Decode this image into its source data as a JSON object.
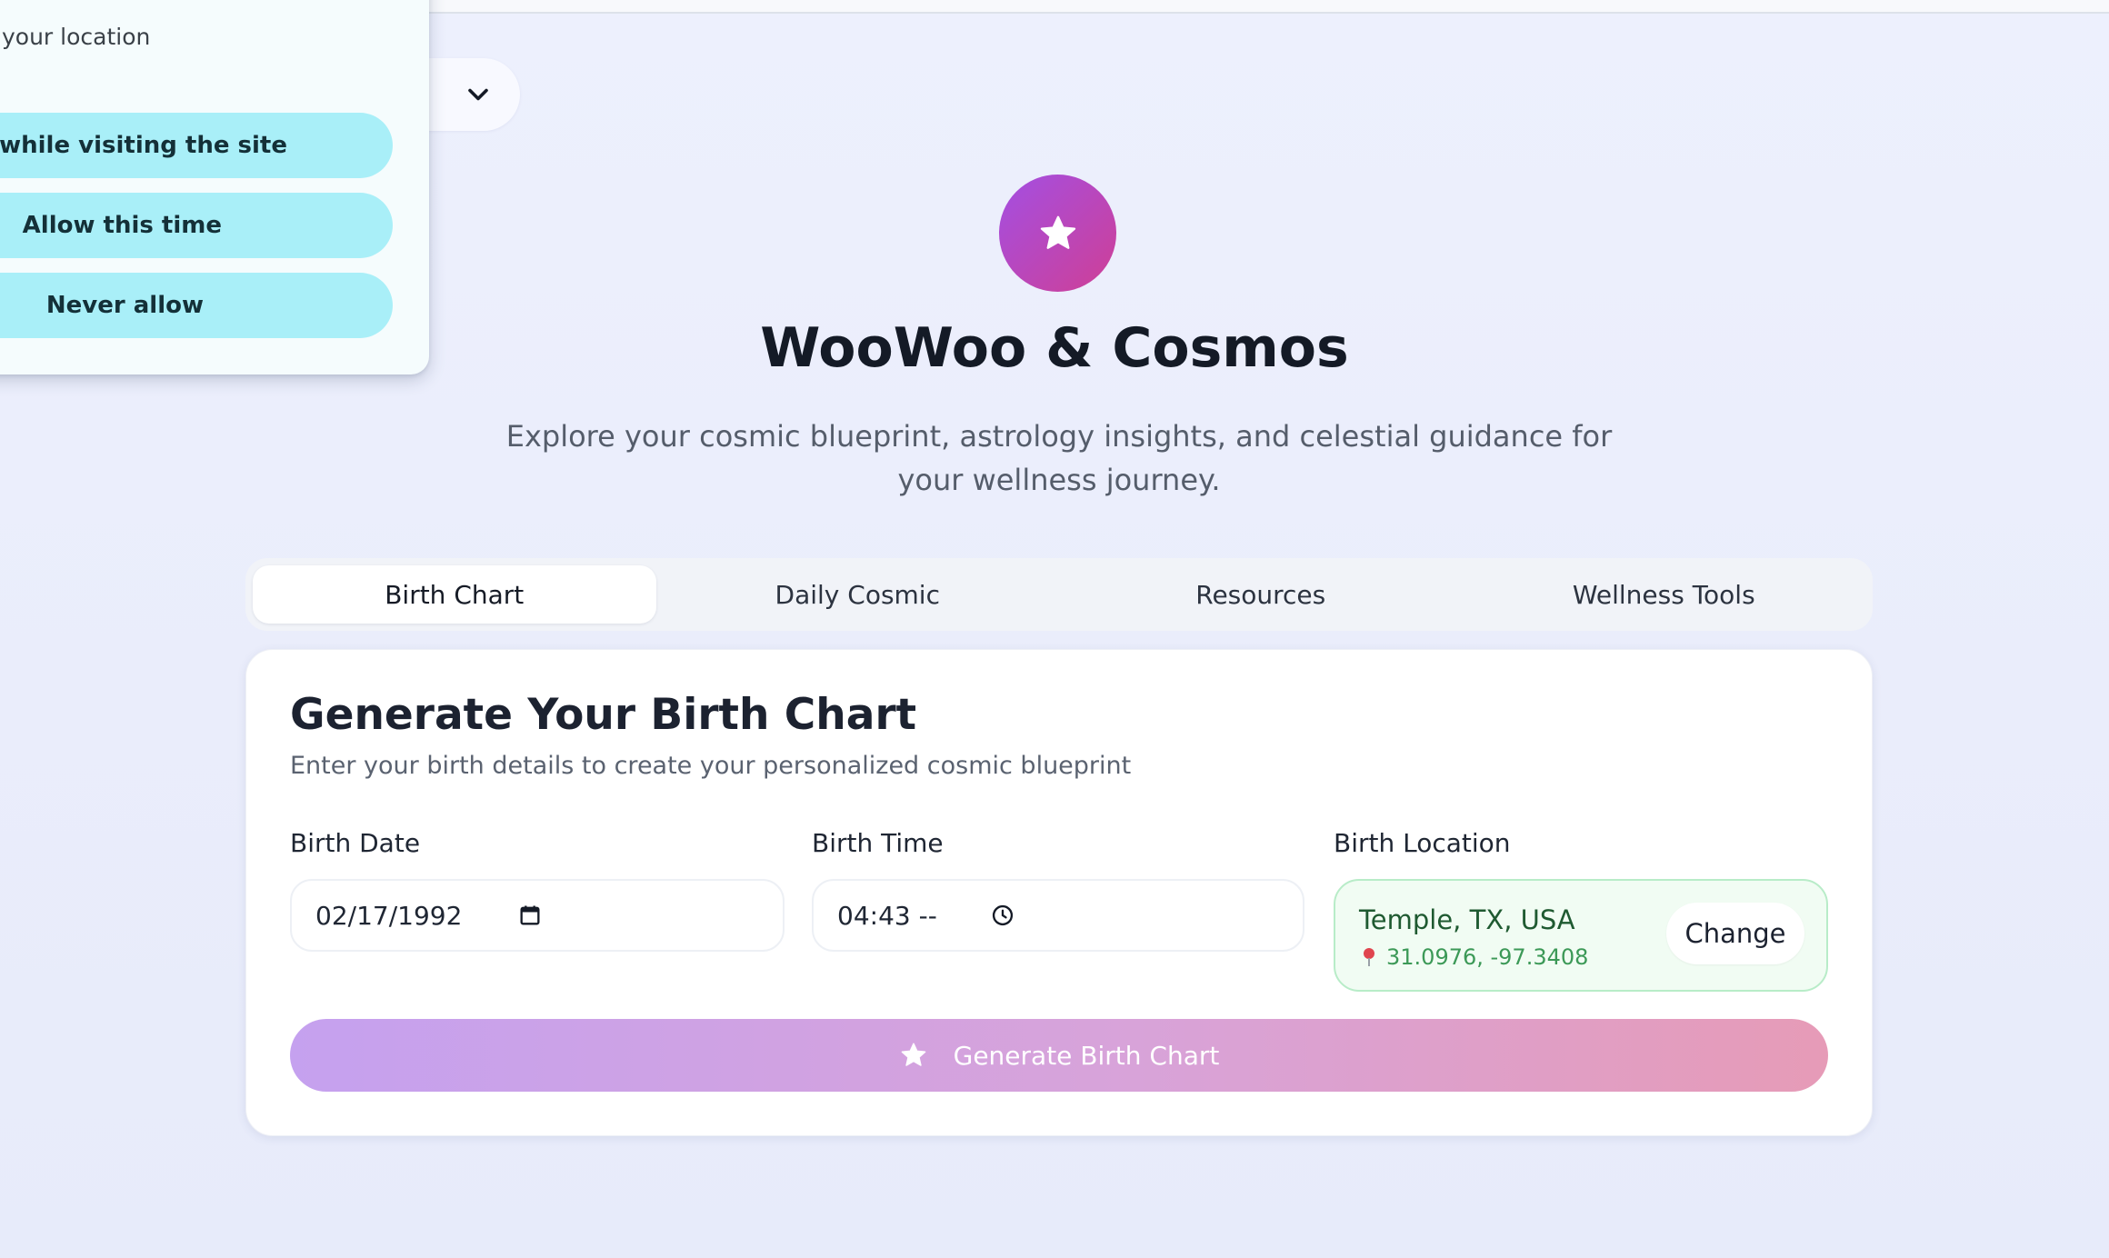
{
  "permission_prompt": {
    "title": "your location",
    "options": [
      "llow while visiting the site",
      "Allow this time",
      "Never allow"
    ]
  },
  "header": {
    "title": "WooWoo & Cosmos",
    "subtitle": "Explore your cosmic blueprint, astrology insights, and celestial guidance for your wellness journey."
  },
  "tabs": [
    {
      "label": "Birth Chart",
      "active": true
    },
    {
      "label": "Daily Cosmic",
      "active": false
    },
    {
      "label": "Resources",
      "active": false
    },
    {
      "label": "Wellness Tools",
      "active": false
    }
  ],
  "form": {
    "title": "Generate Your Birth Chart",
    "description": "Enter your birth details to create your personalized cosmic blueprint",
    "birth_date": {
      "label": "Birth Date",
      "value": "02/17/1992"
    },
    "birth_time": {
      "label": "Birth Time",
      "value": "04:43 --"
    },
    "birth_location": {
      "label": "Birth Location",
      "name": "Temple, TX, USA",
      "coords": "31.0976, -97.3408",
      "change_label": "Change"
    },
    "submit_label": "Generate Birth Chart"
  },
  "colors": {
    "logo_gradient_start": "#a34fe3",
    "logo_gradient_end": "#cf3f95",
    "permission_button": "#a9eff8",
    "location_bg": "#f1fcf3",
    "location_border": "#b8ecc8",
    "button_gradient_start": "#c5a1ef",
    "button_gradient_end": "#e69bb7"
  },
  "icons": {
    "selector": "chevron-down-icon",
    "logo": "star-icon",
    "date": "calendar-icon",
    "time": "clock-icon",
    "location": "pin-icon",
    "submit": "star-icon"
  }
}
